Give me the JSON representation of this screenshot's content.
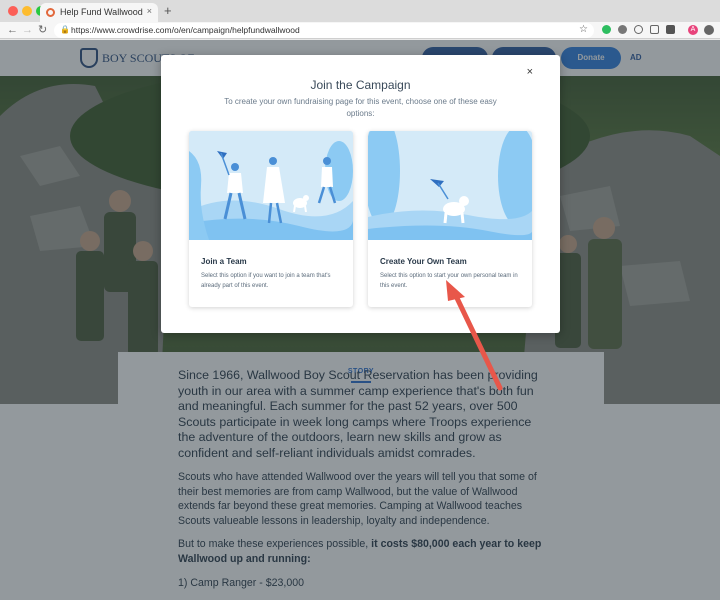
{
  "browser": {
    "tab_title": "Help Fund Wallwood",
    "tab_close": "×",
    "new_tab": "+",
    "url": "https://www.crowdrise.com/o/en/campaign/helpfundwallwood",
    "avatar_letter": "A",
    "nav": {
      "back": "←",
      "forward": "→",
      "reload": "↻"
    },
    "lock": "🔒",
    "bookmark": "☆"
  },
  "header": {
    "org_name": "BOY SCOUTS OF",
    "donate_label": "Donate",
    "ad_label": "AD"
  },
  "story": {
    "tab_label": "STORY",
    "lead": "Since 1966, Wallwood Boy Scout Reservation has been providing youth in our area with a summer camp experience that's both fun and meaningful. Each summer for the past 52 years, over 500 Scouts participate in week long camps where Troops experience the adventure of the outdoors, learn new skills and grow as confident and self-reliant individuals amidst comrades.",
    "para1": "Scouts who have attended Wallwood over the years will tell you that some of their best memories are from camp Wallwood, but the value of Wallwood extends far beyond these great memories. Camping at Wallwood teaches Scouts valueable lessons in leadership, loyalty and independence.",
    "para2_lead": "But to make these experiences possible, ",
    "para2_bold": "it costs $80,000 each year to keep Wallwood up and running:",
    "list_item_1": "1) Camp Ranger - $23,000"
  },
  "modal": {
    "title": "Join the Campaign",
    "subtitle": "To create your own fundraising page for this event, choose one of these easy options:",
    "close": "×",
    "options": [
      {
        "title": "Join a Team",
        "description": "Select this option if you want to join a team that's already part of this event."
      },
      {
        "title": "Create Your Own Team",
        "description": "Select this option to start your own personal team in this event."
      }
    ]
  },
  "colors": {
    "primary": "#2f7fe0",
    "arrow": "#e8574a",
    "illustration_blue": "#5fb4ee"
  }
}
